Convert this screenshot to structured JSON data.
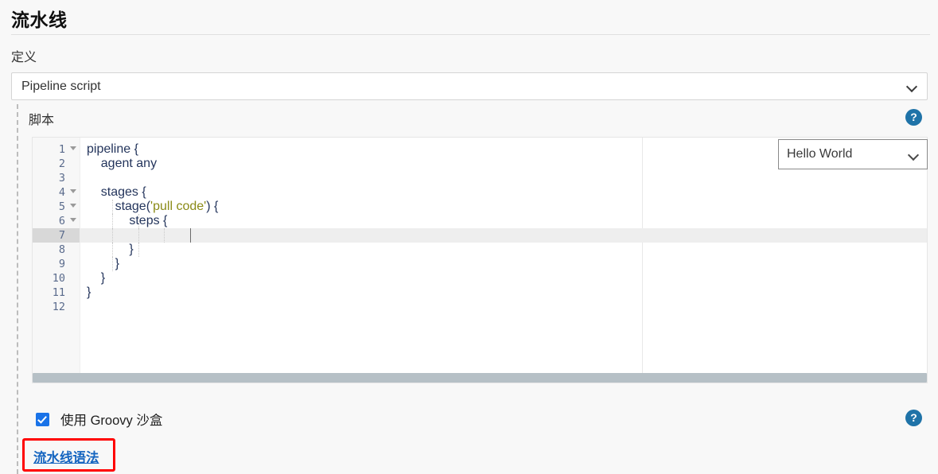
{
  "page": {
    "title": "流水线"
  },
  "definition": {
    "label": "定义",
    "selected": "Pipeline script"
  },
  "script": {
    "label": "脚本",
    "help_icon": "?",
    "sample_selector": {
      "selected": "Hello World"
    },
    "editor": {
      "active_line": 7,
      "total_lines": 12,
      "lines": [
        {
          "no": "1",
          "fold": true,
          "text": "pipeline {"
        },
        {
          "no": "2",
          "fold": false,
          "text": "    agent any"
        },
        {
          "no": "3",
          "fold": false,
          "text": ""
        },
        {
          "no": "4",
          "fold": true,
          "text": "    stages {"
        },
        {
          "no": "5",
          "fold": true,
          "text": "        stage('pull code') {"
        },
        {
          "no": "6",
          "fold": true,
          "text": "            steps {"
        },
        {
          "no": "7",
          "fold": false,
          "text": ""
        },
        {
          "no": "8",
          "fold": false,
          "text": "            }"
        },
        {
          "no": "9",
          "fold": false,
          "text": "        }"
        },
        {
          "no": "10",
          "fold": false,
          "text": "    }"
        },
        {
          "no": "11",
          "fold": false,
          "text": "}"
        },
        {
          "no": "12",
          "fold": false,
          "text": ""
        }
      ],
      "code_plain": "pipeline {\n    agent any\n\n    stages {\n        stage('pull code') {\n            steps {\n\n            }\n        }\n    }\n}\n"
    }
  },
  "sandbox": {
    "label": "使用 Groovy 沙盒",
    "checked": true,
    "help_icon": "?"
  },
  "syntax": {
    "link_label": "流水线语法",
    "highlight_color": "#ff0000"
  },
  "colors": {
    "page_bg": "#f8f8f8",
    "link": "#1565c0",
    "help_blue": "#1f73a8",
    "checkbox_blue": "#1a73e8",
    "code_text": "#24355c",
    "code_string": "#8a8a16",
    "gutter_number": "#5a6b8c",
    "annotation_red": "#ff0000"
  }
}
